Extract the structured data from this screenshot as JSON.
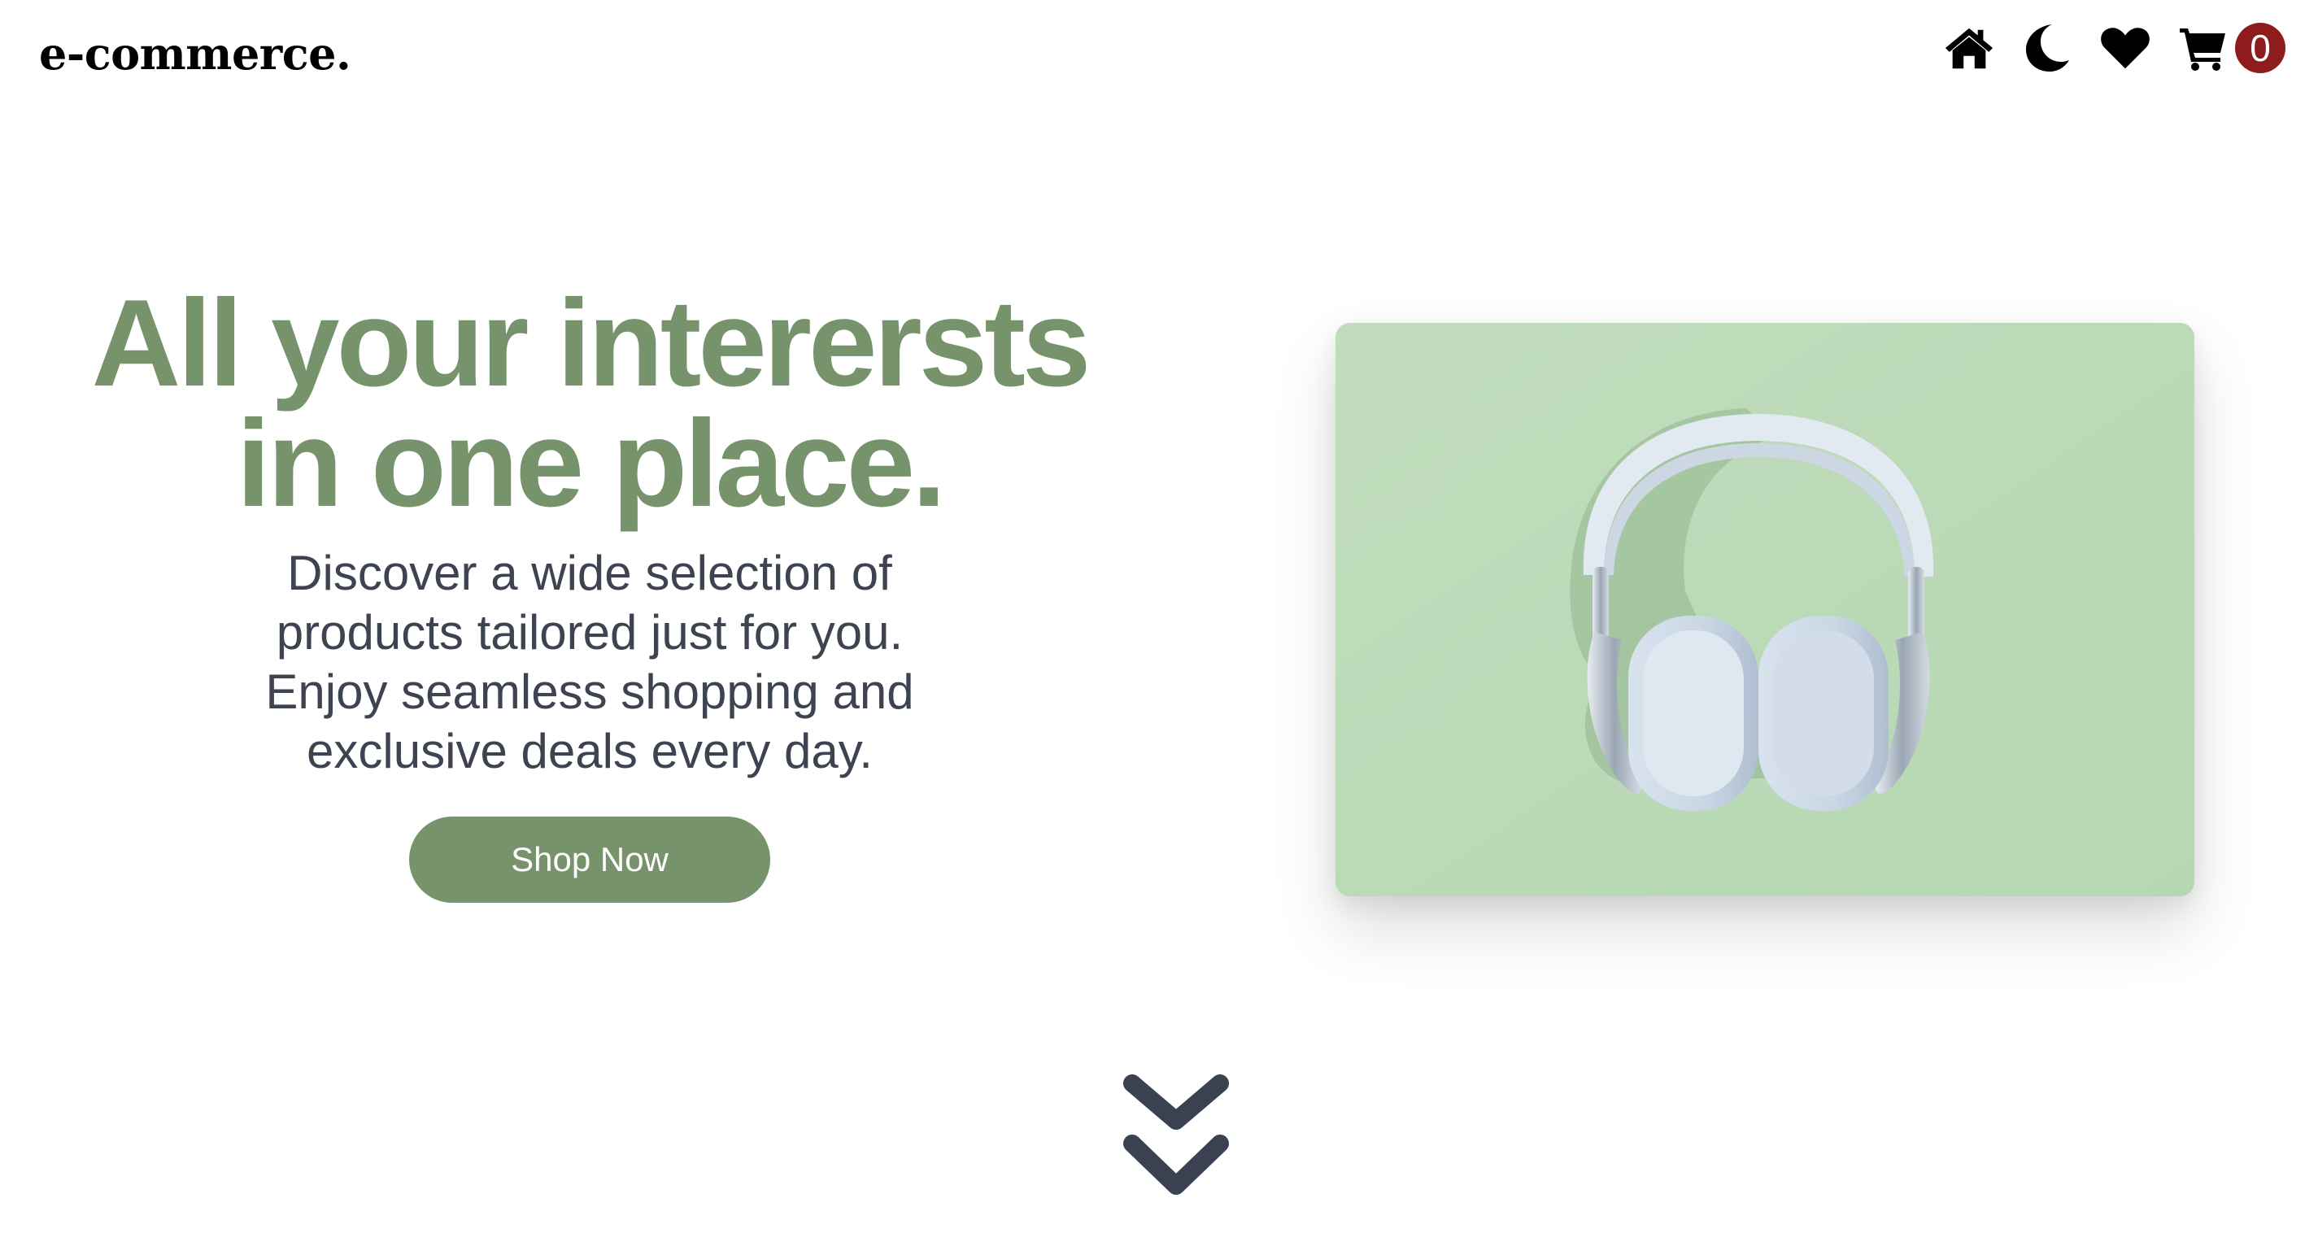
{
  "header": {
    "brand": "e-commerce.",
    "nav": {
      "home_icon": "home-icon",
      "theme_icon": "moon-icon",
      "wishlist_icon": "heart-icon",
      "cart_icon": "cart-icon",
      "cart_count": "0"
    }
  },
  "hero": {
    "title_line1": "All your interersts",
    "title_line2": "in one place.",
    "description": "Discover a wide selection of products tailored just for you. Enjoy seamless shopping and exclusive deals every day.",
    "cta_label": "Shop Now",
    "image_subject": "headphones-image"
  },
  "scroll": {
    "icon": "double-chevron-down-icon"
  },
  "colors": {
    "accent": "#76936b",
    "text": "#3d4351",
    "badge": "#8e1c1c",
    "card_bg": "#bcdcb8"
  }
}
